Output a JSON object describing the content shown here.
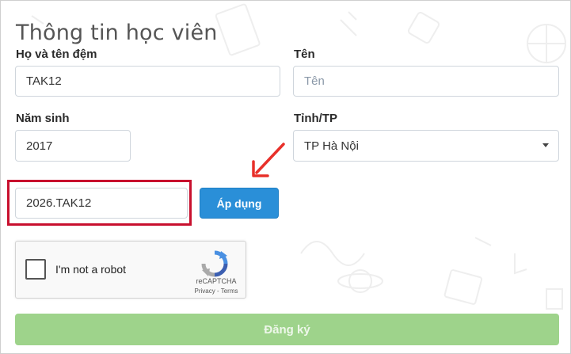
{
  "form": {
    "title": "Thông tin học viên",
    "last_name_label": "Họ và tên đệm",
    "last_name_value": "TAK12",
    "first_name_label": "Tên",
    "first_name_placeholder": "Tên",
    "birth_year_label": "Năm sinh",
    "birth_year_value": "2017",
    "province_label": "Tỉnh/TP",
    "province_value": "TP Hà Nội",
    "promo_value": "2026.TAK12",
    "apply_label": "Áp dụng",
    "submit_label": "Đăng ký"
  },
  "captcha": {
    "label": "I'm not a robot",
    "brand": "reCAPTCHA",
    "links": "Privacy - Terms"
  },
  "colors": {
    "highlight": "#c8102e",
    "apply_button": "#2a8fd8",
    "submit_button": "#9ed38b"
  }
}
